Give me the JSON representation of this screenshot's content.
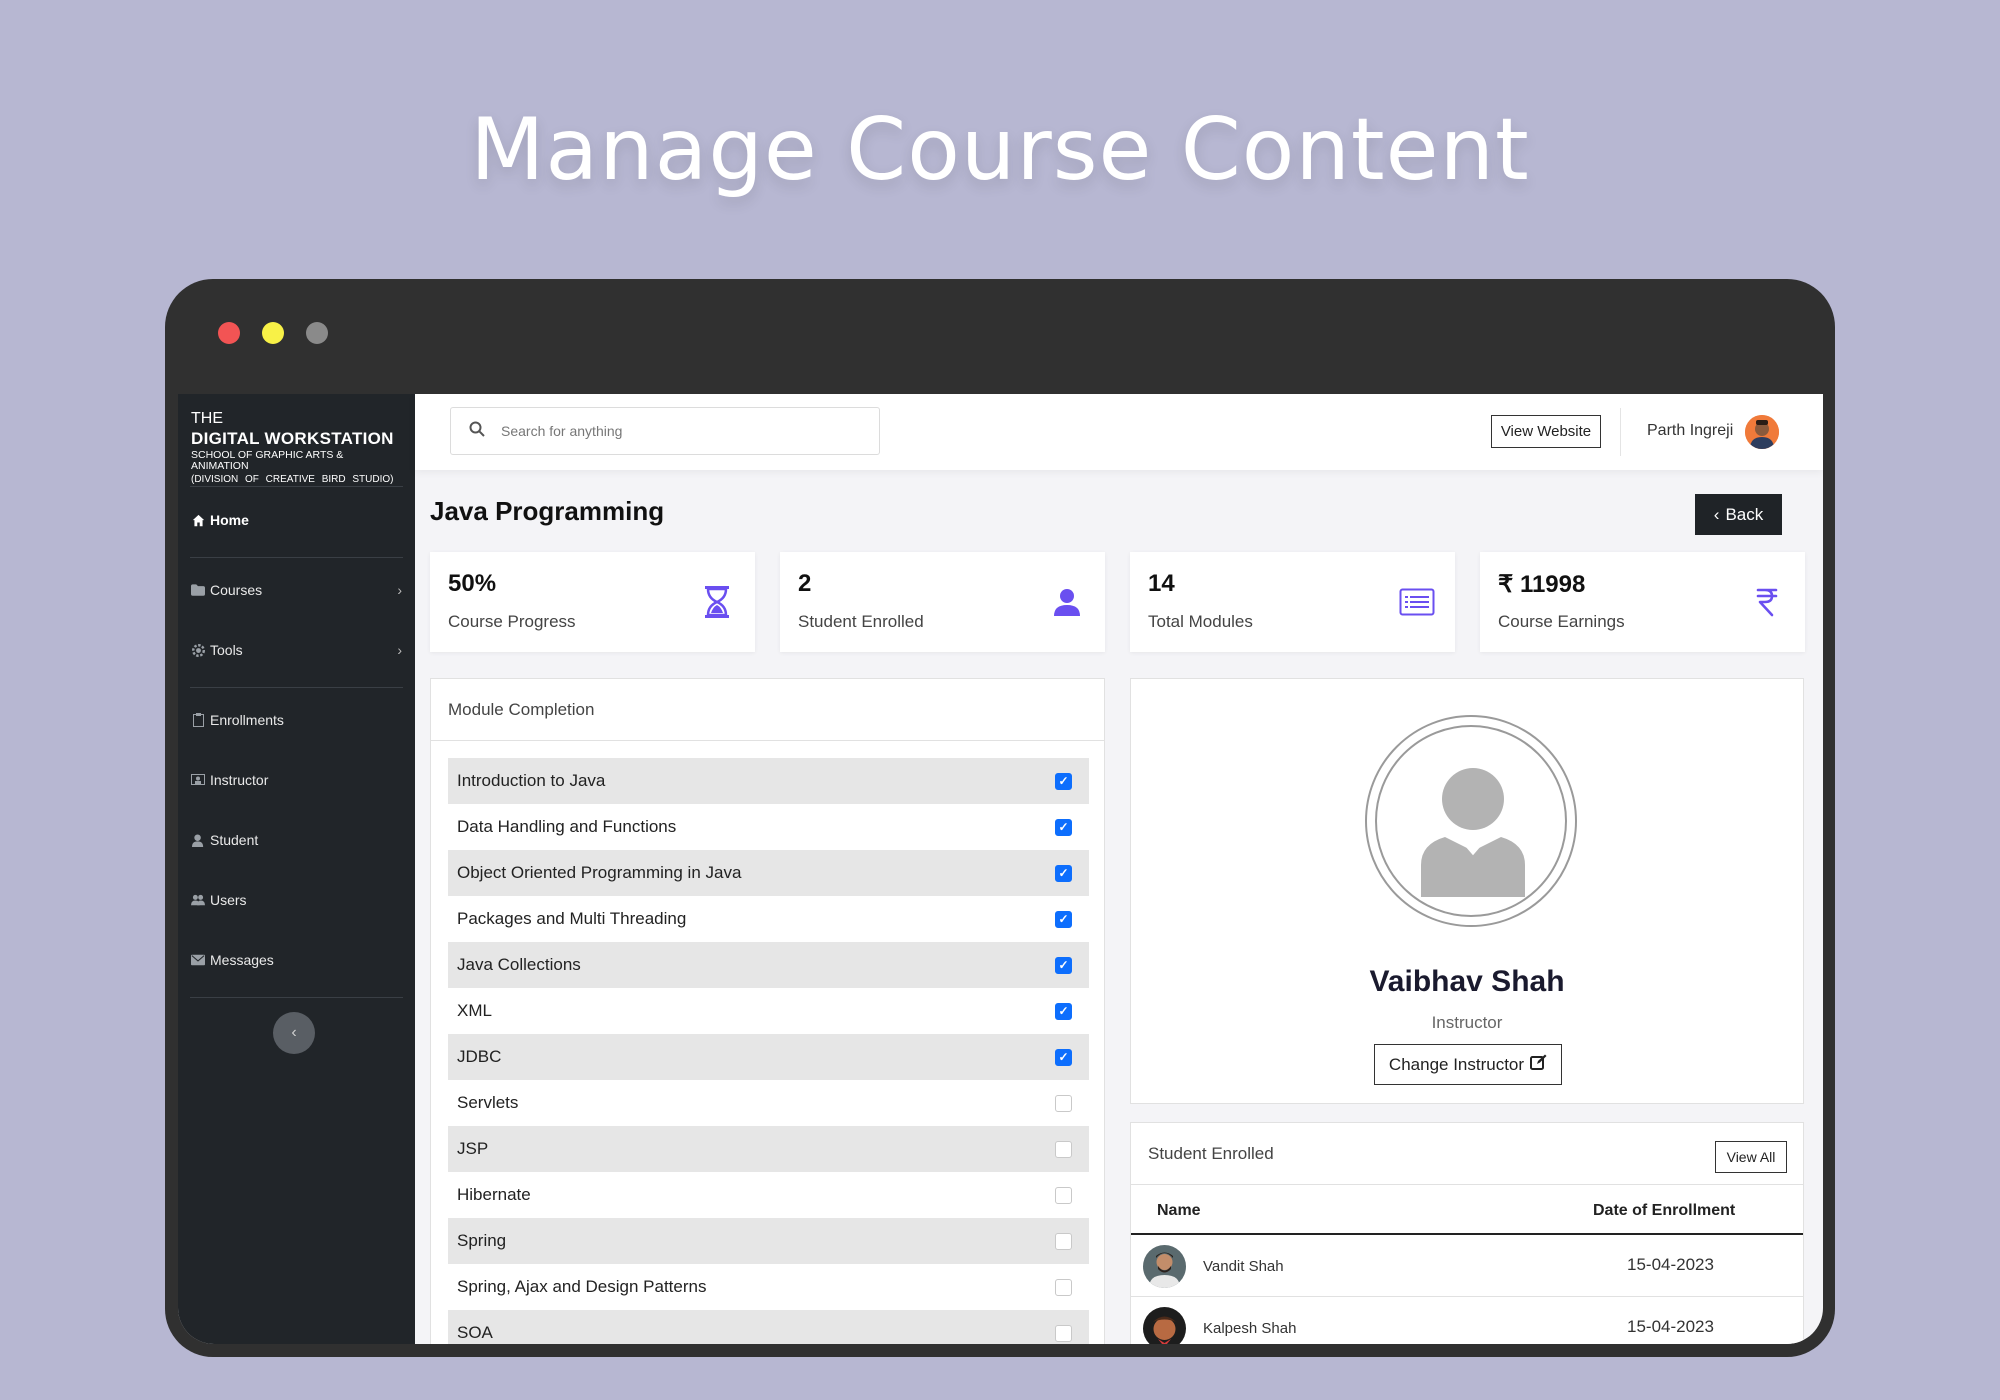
{
  "hero": {
    "title": "Manage Course Content"
  },
  "window": {
    "dot_colors": [
      "#f25454",
      "#f8f147",
      "#8a8a8a"
    ]
  },
  "logo": {
    "line1": "THE",
    "line2": "DIGITAL WORKSTATION",
    "line3": "SCHOOL OF GRAPHIC ARTS & ANIMATION",
    "line4": "(DIVISION OF CREATIVE BIRD STUDIO)"
  },
  "sidebar": {
    "items": [
      {
        "label": "Home",
        "icon": "home-icon"
      },
      {
        "label": "Courses",
        "icon": "folder-icon"
      },
      {
        "label": "Tools",
        "icon": "gear-icon"
      },
      {
        "label": "Enrollments",
        "icon": "clipboard-icon"
      },
      {
        "label": "Instructor",
        "icon": "presentation-icon"
      },
      {
        "label": "Student",
        "icon": "user-icon"
      },
      {
        "label": "Users",
        "icon": "users-icon"
      },
      {
        "label": "Messages",
        "icon": "message-icon"
      }
    ]
  },
  "header": {
    "search_placeholder": "Search for anything",
    "view_website": "View Website",
    "user_name": "Parth Ingreji"
  },
  "page": {
    "title": "Java Programming",
    "back_label": "Back"
  },
  "stats": [
    {
      "value": "50%",
      "label": "Course Progress",
      "icon": "hourglass-icon"
    },
    {
      "value": "2",
      "label": "Student Enrolled",
      "icon": "user-icon"
    },
    {
      "value": "14",
      "label": "Total Modules",
      "icon": "list-icon"
    },
    {
      "value": "₹ 11998",
      "label": "Course Earnings",
      "icon": "rupee-icon"
    }
  ],
  "accent_color": "#6a4ff0",
  "modules": {
    "title": "Module Completion",
    "items": [
      {
        "name": "Introduction to Java",
        "done": true
      },
      {
        "name": "Data Handling and Functions",
        "done": true
      },
      {
        "name": "Object Oriented Programming in Java",
        "done": true
      },
      {
        "name": "Packages and Multi Threading",
        "done": true
      },
      {
        "name": "Java Collections",
        "done": true
      },
      {
        "name": "XML",
        "done": true
      },
      {
        "name": "JDBC",
        "done": true
      },
      {
        "name": "Servlets",
        "done": false
      },
      {
        "name": "JSP",
        "done": false
      },
      {
        "name": "Hibernate",
        "done": false
      },
      {
        "name": "Spring",
        "done": false
      },
      {
        "name": "Spring, Ajax and Design Patterns",
        "done": false
      },
      {
        "name": "SOA",
        "done": false
      }
    ]
  },
  "instructor": {
    "name": "Vaibhav Shah",
    "role": "Instructor",
    "change_label": "Change Instructor"
  },
  "students": {
    "title": "Student Enrolled",
    "view_all": "View All",
    "columns": [
      "Name",
      "Date of Enrollment"
    ],
    "rows": [
      {
        "name": "Vandit Shah",
        "date": "15-04-2023"
      },
      {
        "name": "Kalpesh Shah",
        "date": "15-04-2023"
      }
    ]
  }
}
